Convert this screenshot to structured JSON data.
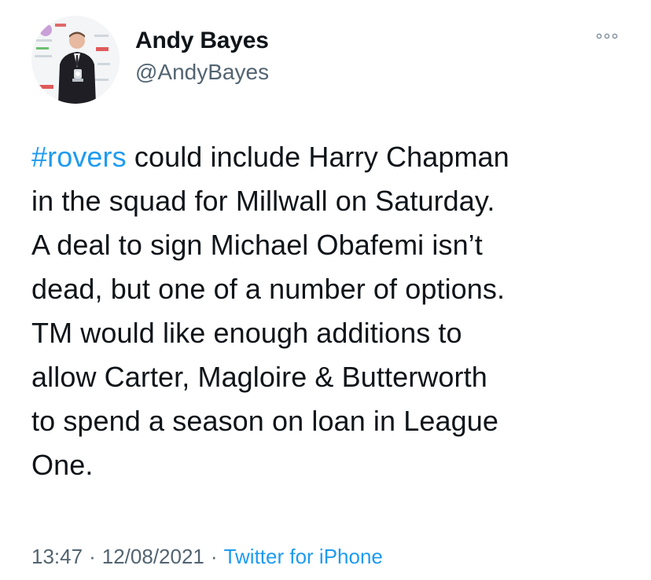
{
  "author": {
    "display_name": "Andy Bayes",
    "handle": "@AndyBayes"
  },
  "tweet": {
    "hashtag": "#rovers",
    "text": " could include Harry Chapman\nin the squad for Millwall on Saturday.\nA deal to sign Michael Obafemi isn’t\ndead, but one of a number of options.\nTM would like enough additions to\nallow Carter, Magloire & Butterworth\nto spend a season on loan in League\nOne."
  },
  "meta": {
    "time": "13:47",
    "separator": "·",
    "date": "12/08/2021",
    "source": "Twitter for iPhone"
  },
  "icons": {
    "more": "more-horizontal-icon"
  },
  "colors": {
    "link": "#1d9bf0",
    "text": "#0f1419",
    "muted": "#536471"
  }
}
